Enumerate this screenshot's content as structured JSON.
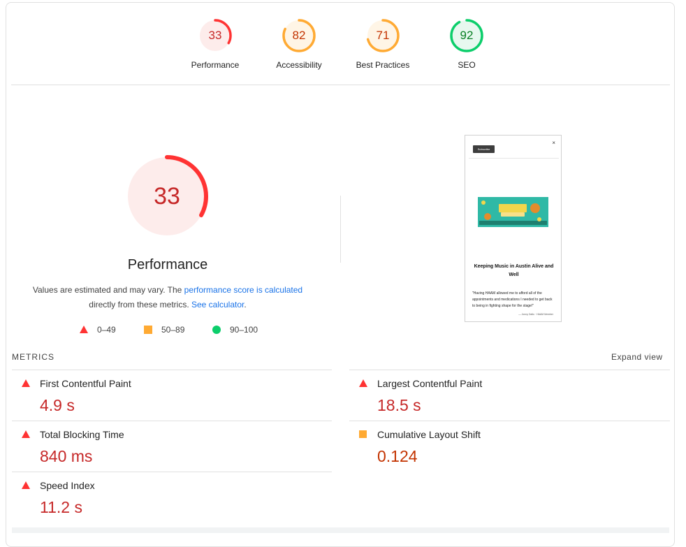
{
  "scores": [
    {
      "label": "Performance",
      "score": 33,
      "color": "#ff3333",
      "fill": "#fdeceb",
      "text": "#c62828"
    },
    {
      "label": "Accessibility",
      "score": 82,
      "color": "#ffaa33",
      "fill": "#fff5e6",
      "text": "#c33300"
    },
    {
      "label": "Best Practices",
      "score": 71,
      "color": "#ffaa33",
      "fill": "#fff5e6",
      "text": "#c33300"
    },
    {
      "label": "SEO",
      "score": 92,
      "color": "#0cce6b",
      "fill": "#e7f8ef",
      "text": "#087f23"
    }
  ],
  "main": {
    "score": 33,
    "title": "Performance",
    "desc_1": "Values are estimated and may vary. The ",
    "desc_link_1": "performance score is calculated",
    "desc_2": "directly from these metrics. ",
    "desc_link_2": "See calculator",
    "desc_3": "."
  },
  "legend": [
    {
      "shape": "triangle",
      "range": "0–49",
      "color": "#ff3333"
    },
    {
      "shape": "square",
      "range": "50–89",
      "color": "#ffaa33"
    },
    {
      "shape": "circle",
      "range": "90–100",
      "color": "#0cce6b"
    }
  ],
  "screenshot": {
    "subscribe": "Subscribe",
    "close": "×",
    "heading": "Keeping Music in Austin Alive and Well",
    "quote": "\"Having HAAM allowed me to afford all of the appointments and medications I needed to get back to being in fighting shape for the stage!\"",
    "cite": "— Jonny Dallo · HAAM Member"
  },
  "metrics_label": "METRICS",
  "expand_label": "Expand view",
  "metrics": [
    {
      "name": "First Contentful Paint",
      "value": "4.9 s",
      "status": "fail"
    },
    {
      "name": "Largest Contentful Paint",
      "value": "18.5 s",
      "status": "fail"
    },
    {
      "name": "Total Blocking Time",
      "value": "840 ms",
      "status": "fail"
    },
    {
      "name": "Cumulative Layout Shift",
      "value": "0.124",
      "status": "average"
    },
    {
      "name": "Speed Index",
      "value": "11.2 s",
      "status": "fail"
    }
  ]
}
